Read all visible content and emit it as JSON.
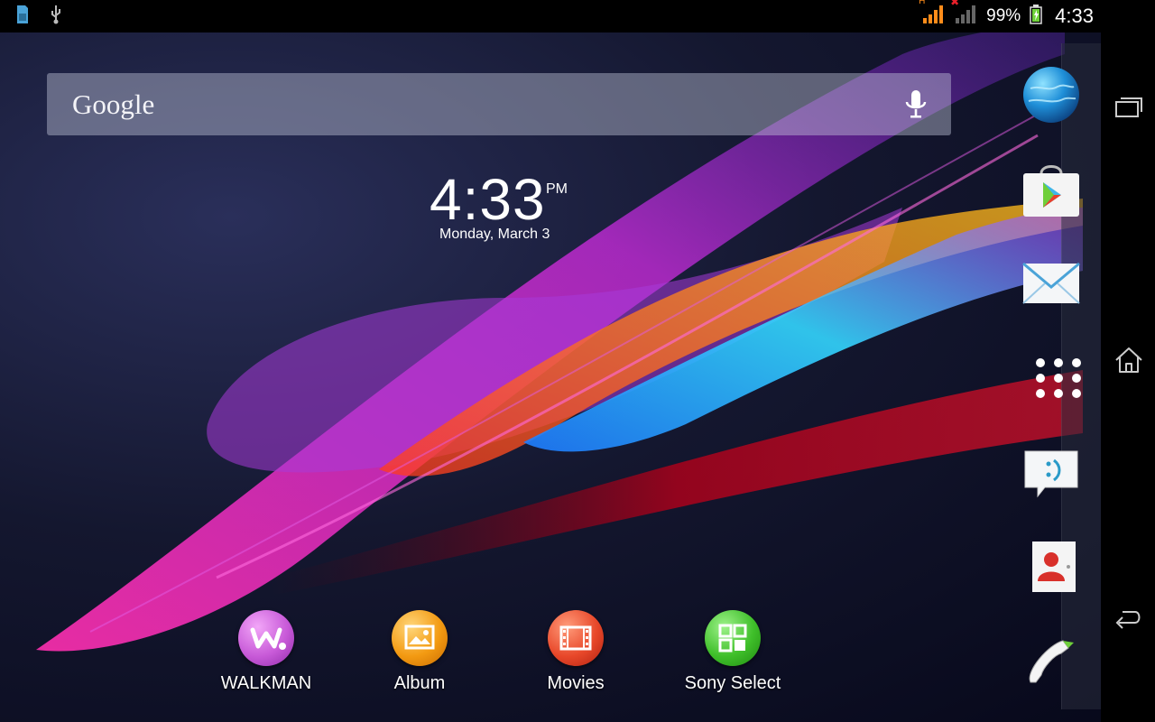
{
  "status_bar": {
    "network_type": "H",
    "battery_percent": "99%",
    "time": "4:33",
    "icons": [
      "sim-icon",
      "usb-icon",
      "signal-icon",
      "no-signal-icon",
      "battery-charging-icon"
    ]
  },
  "search": {
    "logo_text": "Google",
    "mic_icon": "microphone-icon"
  },
  "clock": {
    "time": "4:33",
    "ampm": "PM",
    "date": "Monday, March 3"
  },
  "dock": {
    "items": [
      {
        "label": "WALKMAN",
        "icon": "walkman-icon",
        "color": "#c85ad8"
      },
      {
        "label": "Album",
        "icon": "album-icon",
        "color": "#f39a12"
      },
      {
        "label": "Movies",
        "icon": "movies-icon",
        "color": "#e8482a"
      },
      {
        "label": "Sony Select",
        "icon": "sony-select-icon",
        "color": "#3fbf2a"
      }
    ]
  },
  "favorites": {
    "items": [
      {
        "icon": "browser-globe-icon"
      },
      {
        "icon": "play-store-icon"
      },
      {
        "icon": "email-icon"
      },
      {
        "icon": "app-drawer-icon"
      },
      {
        "icon": "messaging-icon"
      },
      {
        "icon": "contacts-icon"
      },
      {
        "icon": "phone-icon"
      }
    ]
  },
  "nav_bar": {
    "buttons": [
      "recent-apps-icon",
      "home-icon",
      "back-icon"
    ]
  }
}
